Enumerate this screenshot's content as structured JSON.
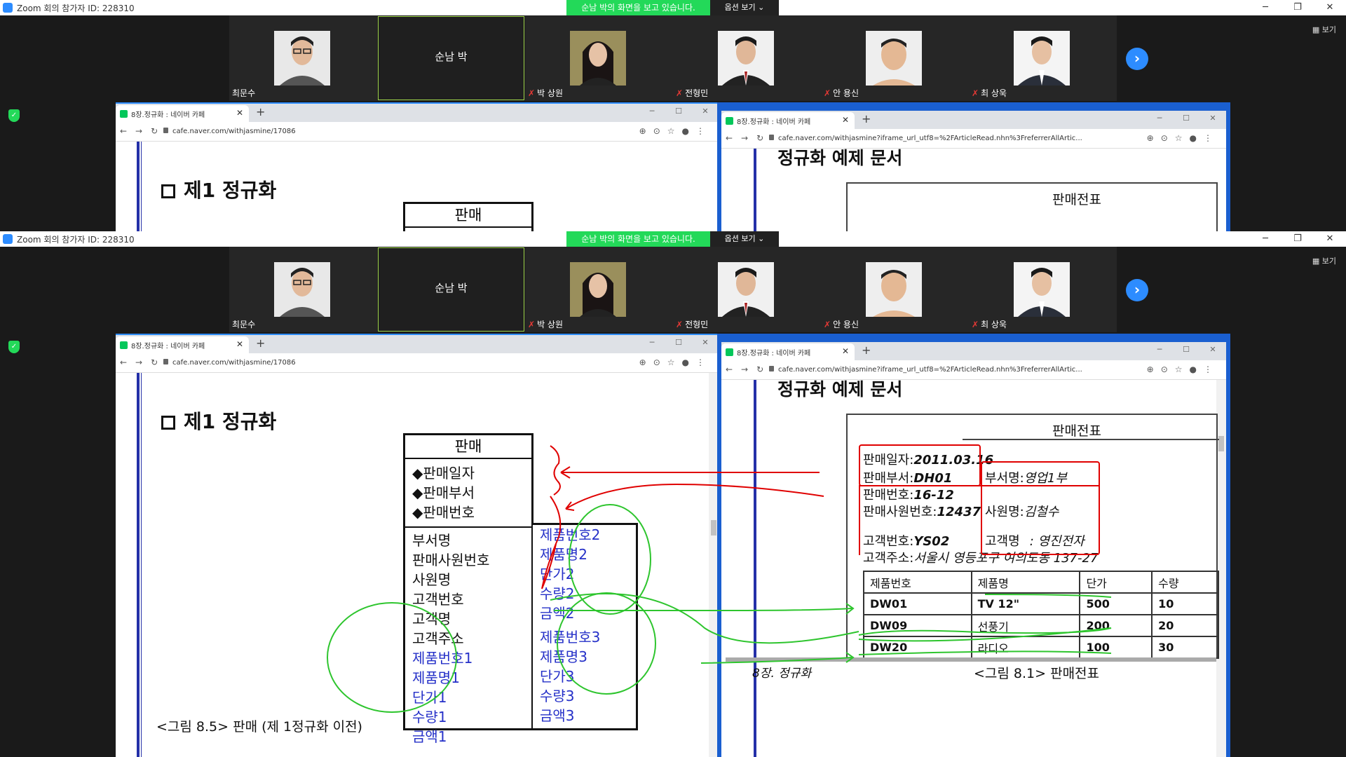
{
  "zoom": {
    "title": "Zoom 회의 참가자 ID: 228310",
    "banner": "순남 박의 화면을 보고 있습니다.",
    "options": "옵션 보기 ⌄",
    "view": "보기",
    "active_speaker": "순남 박",
    "participants": [
      {
        "name": "최문수",
        "muted": false,
        "photo": true
      },
      {
        "name": "순남 박",
        "muted": false,
        "photo": false
      },
      {
        "name": "박 상원",
        "muted": true,
        "photo": true
      },
      {
        "name": "전형민",
        "muted": true,
        "photo": true
      },
      {
        "name": "안 용신",
        "muted": true,
        "photo": true
      },
      {
        "name": "최 상욱",
        "muted": true,
        "photo": true
      }
    ]
  },
  "browser_left": {
    "tab": "8장.정규화 : 네이버 카페",
    "url": "cafe.naver.com/withjasmine/17086"
  },
  "browser_right": {
    "tab": "8장.정규화 : 네이버 카페",
    "url": "cafe.naver.com/withjasmine?iframe_url_utf8=%2FArticleRead.nhn%3FreferrerAllArtic..."
  },
  "left_doc": {
    "heading": "제1 정규화",
    "table_title": "판매",
    "keys": [
      "◆판매일자",
      "◆판매부서",
      "◆판매번호"
    ],
    "attrs": [
      "부서명",
      "판매사원번호",
      "사원명",
      "고객번호",
      "고객명",
      "고객주소"
    ],
    "group1": [
      "제품번호1",
      "제품명1",
      "단가1",
      "수량1",
      "금액1"
    ],
    "group2": [
      "제품번호2",
      "제품명2",
      "단가2",
      "수량2",
      "금액2"
    ],
    "group3": [
      "제품번호3",
      "제품명3",
      "단가3",
      "수량3",
      "금액3"
    ],
    "caption": "<그림 8.5> 판매 (제 1정규화 이전)"
  },
  "right_doc": {
    "heading_partial": "정규화 예제 문서",
    "form_title": "판매전표",
    "sale_date_label": "판매일자:",
    "sale_date": "2011.03.16",
    "sale_dept_label": "판매부서:",
    "sale_dept": "DH01",
    "dept_name_label": "부서명:",
    "dept_name": "영업1부",
    "sale_no_label": "판매번호:",
    "sale_no": "16-12",
    "emp_no_label": "판매사원번호:",
    "emp_no": "12437",
    "emp_name_label": "사원명:",
    "emp_name": "김철수",
    "cust_no_label": "고객번호:",
    "cust_no": "YS02",
    "cust_name_label": "고객명",
    "cust_name": ": 영진전자",
    "cust_addr_label": "고객주소:",
    "cust_addr": "서울시 영등포구 여의도동 137-27",
    "items_header": [
      "제품번호",
      "제품명",
      "단가",
      "수량"
    ],
    "items": [
      [
        "DW01",
        "TV 12\"",
        "500",
        "10"
      ],
      [
        "DW09",
        "선풍기",
        "200",
        "20"
      ],
      [
        "DW20",
        "라디오",
        "100",
        "30"
      ]
    ],
    "footer_left": "8장. 정규화",
    "footer_right": "<그림 8.1> 판매전표"
  },
  "colors": {
    "zoom_green": "#23d959",
    "zoom_blue": "#2d8cff",
    "annotation_red": "#e00000",
    "annotation_green": "#2ec52e",
    "doc_blue": "#2530c8"
  }
}
